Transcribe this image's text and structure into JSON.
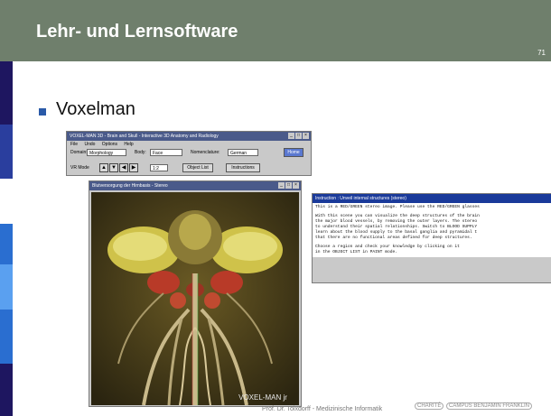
{
  "slide": {
    "title": "Lehr- und Lernsoftware",
    "number": "71",
    "bullet": "Voxelman",
    "footer": "Prof. Dr. Tolxdorff - Medizinische Informatik",
    "logo_charite": "CHARITÉ",
    "logo_campus": "CAMPUS BENJAMIN FRANKLIN",
    "colors": {
      "header": "#6f7f6c",
      "bullet": "#2a5aa8"
    }
  },
  "toolbar_window": {
    "title": "VOXEL-MAN 3D - Brain and Skull - Interactive 3D Anatomy and Radiology",
    "menu": [
      "File",
      "Undo",
      "Options",
      "Help"
    ],
    "domain_label": "Domain:",
    "domain_value": "Morphology",
    "body_label": "Body:",
    "body_value": "Face",
    "nomenclature_label": "Nomenclature:",
    "nomenclature_value": "German",
    "home_button": "Home",
    "vr_mode_label": "VR Mode",
    "zoom_value": "1:2",
    "object_list_button": "Object List",
    "instructions_button": "Instructions"
  },
  "image_window": {
    "title": "Blutversorgung der Hirnbasis - Stereo",
    "watermark": "VOXEL-MAN jr"
  },
  "instruction_window": {
    "title": "Instruction : Unveil internal structures (stereo)",
    "lines": [
      "This is a RED/GREEN stereo image. Please use the RED/GREEN glasses",
      "With this scene you can visualize the deep structures of the brain",
      "the major blood vessels, by removing the outer layers. The stereo",
      "to understand their spatial relationships. Switch to BLOOD SUPPLY",
      "learn about the blood supply to the basal ganglia and pyramidal t",
      "that there are no functional areas defined for deep structures.",
      "Choose a region and check your knowledge by clicking on it",
      "in the OBJECT LIST in PAINT mode."
    ]
  }
}
